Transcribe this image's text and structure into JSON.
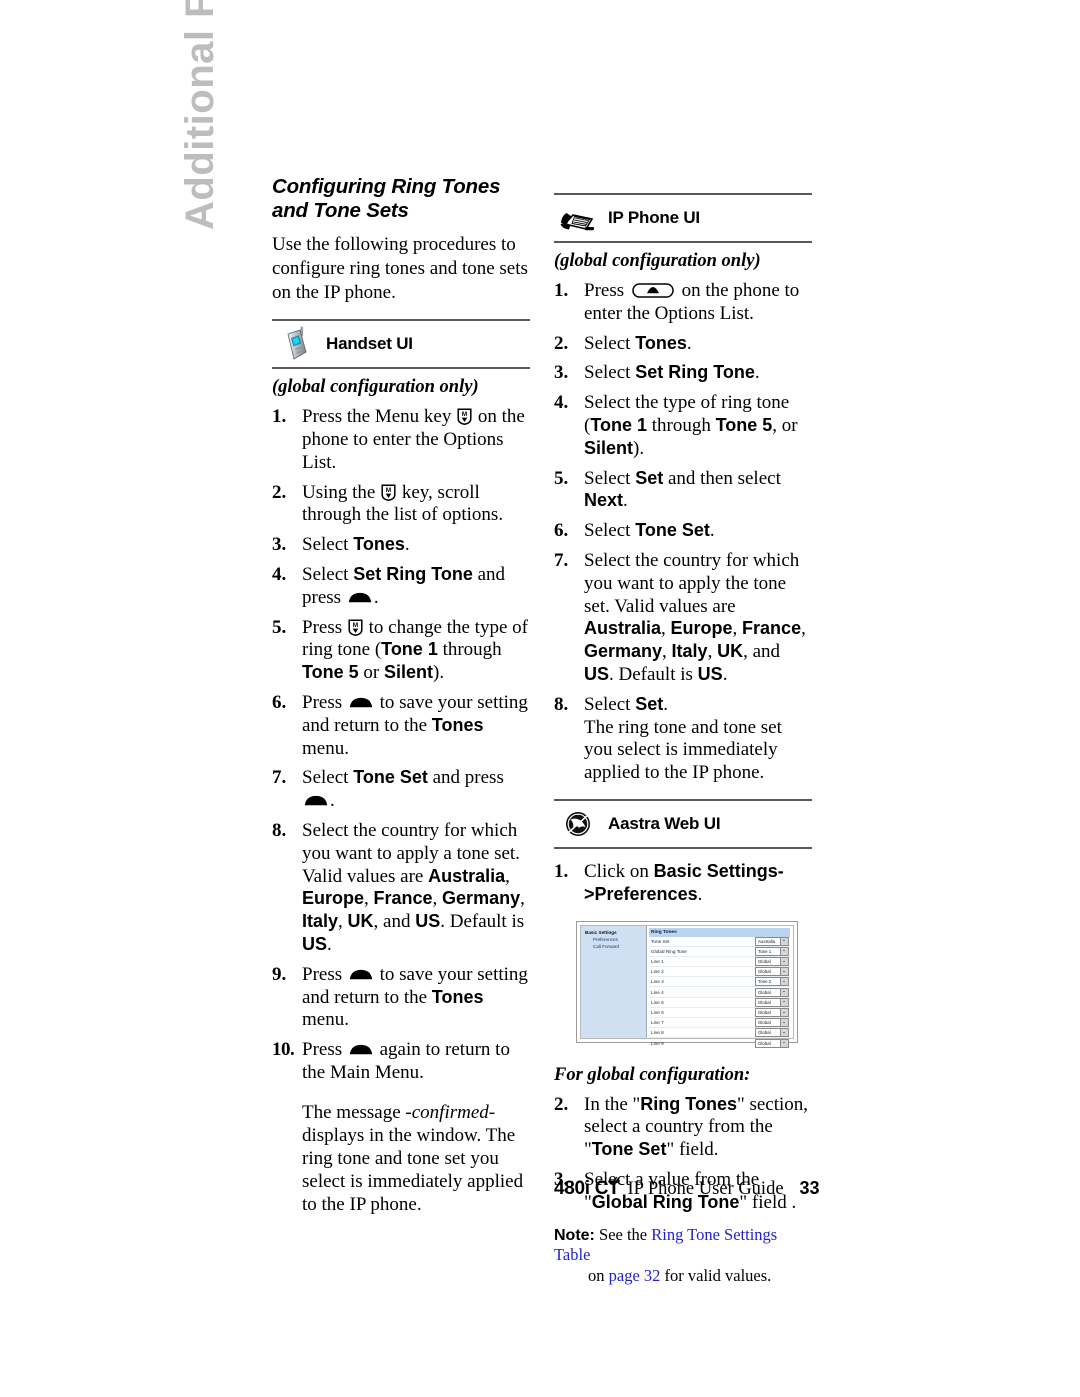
{
  "chapter_tab": {
    "label": "Additional Features"
  },
  "section": {
    "title": "Configuring Ring Tones and Tone Sets",
    "intro": "Use the following procedures to configure ring tones and tone sets on the IP phone."
  },
  "handset_ui": {
    "icon": "cordless-handset-icon",
    "label": "Handset UI",
    "scope_note": "(global configuration only)",
    "steps": [
      {
        "num": "1.",
        "text_before": "Press the Menu key ",
        "glyph": "menu-key-icon",
        "text_after": " on the phone to enter the Options List."
      },
      {
        "num": "2.",
        "text_before": "Using the ",
        "glyph": "menu-key-icon",
        "text_after": " key, scroll through the list of options."
      },
      {
        "num": "3.",
        "text_before": "Select ",
        "bold": "Tones",
        "text_after": "."
      },
      {
        "num": "4.",
        "text_before": "Select ",
        "bold": "Set Ring Tone",
        "text_mid": " and press ",
        "glyph": "dome-key-icon",
        "text_after": "."
      },
      {
        "num": "5.",
        "text_before": "Press ",
        "glyph": "menu-key-icon",
        "text_mid": " to change the type of ring tone (",
        "bold": "Tone 1",
        "text_mid2": " through ",
        "bold2": "Tone 5",
        "text_mid3": " or ",
        "bold3": "Silent",
        "text_after": ")."
      },
      {
        "num": "6.",
        "text_before": "Press ",
        "glyph": "dome-key-icon",
        "text_mid": " to save your setting and return to the ",
        "bold": "Tones",
        "text_after": " menu."
      },
      {
        "num": "7.",
        "text_before": "Select ",
        "bold": "Tone Set",
        "text_mid": " and press ",
        "glyph": "dome-key-icon",
        "text_after": "."
      },
      {
        "num": "8.",
        "text_before": "Select the country for which you want to apply a tone set. Valid values are ",
        "bold": "Australia",
        "sep1": ", ",
        "bold2": "Europe",
        "sep2": ", ",
        "bold3": "France",
        "sep3": ", ",
        "bold4": "Germany",
        "sep4": ", ",
        "bold5": "Italy",
        "sep5": ", ",
        "bold6": "UK",
        "sep6": ", and ",
        "bold7": "US",
        "sep7": ". Default is ",
        "bold8": "US",
        "text_after": "."
      },
      {
        "num": "9.",
        "text_before": "Press ",
        "glyph": "dome-key-icon",
        "text_mid": " to save your setting and return to the ",
        "bold": "Tones",
        "text_after": " menu."
      },
      {
        "num": "10.",
        "text_before": "Press ",
        "glyph": "dome-key-icon",
        "text_after": " again to return to the Main Menu."
      }
    ],
    "closing_paragraph_a": "The message ",
    "closing_paragraph_em": "-confirmed-",
    "closing_paragraph_b": " displays in the window. The ring tone and tone set you select is immediately applied to the IP phone."
  },
  "ip_phone_ui": {
    "icon": "desk-phone-icon",
    "label": "IP Phone UI",
    "scope_note": "(global configuration only)",
    "steps": [
      {
        "num": "1.",
        "text_before": "Press ",
        "glyph": "oval-up-key-icon",
        "text_after": " on the phone to enter the Options List."
      },
      {
        "num": "2.",
        "text_before": "Select ",
        "bold": "Tones",
        "text_after": "."
      },
      {
        "num": "3.",
        "text_before": "Select ",
        "bold": "Set Ring Tone",
        "text_after": "."
      },
      {
        "num": "4.",
        "text_before": "Select the type of ring tone (",
        "bold": "Tone 1",
        "text_mid": " through ",
        "bold2": "Tone 5",
        "text_mid2": ", or ",
        "bold3": "Silent",
        "text_after": ")."
      },
      {
        "num": "5.",
        "text_before": "Select ",
        "bold": "Set",
        "text_mid": " and then select ",
        "bold2": "Next",
        "text_after": "."
      },
      {
        "num": "6.",
        "text_before": "Select ",
        "bold": "Tone Set",
        "text_after": "."
      },
      {
        "num": "7.",
        "text_before": "Select the country for which you want to apply the tone set. Valid values are ",
        "bold": "Australia",
        "sep1": ", ",
        "bold2": "Europe",
        "sep2": ", ",
        "bold3": "France",
        "sep3": ", ",
        "bold4": "Germany",
        "sep4": ", ",
        "bold5": "Italy",
        "sep5": ", ",
        "bold6": "UK",
        "sep6": ", and ",
        "bold7": "US",
        "sep7": ". Default is ",
        "bold8": "US",
        "text_after": "."
      },
      {
        "num": "8.",
        "text_before": "Select ",
        "bold": "Set",
        "text_after": ".",
        "extra": "The ring tone and tone set you select is immediately applied to the IP phone."
      }
    ]
  },
  "aastra_web_ui": {
    "icon": "globe-icon",
    "label": "Aastra Web UI",
    "step1": {
      "num": "1.",
      "text_before": "Click on ",
      "bold": "Basic Settings->",
      "bold2": "Preferences",
      "text_after": "."
    },
    "screenshot": {
      "nav_title": "Basic Settings",
      "nav_items": [
        "Preferences",
        "Call Forward"
      ],
      "section_header": "Ring Tones",
      "rows": [
        {
          "label": "Tone Set",
          "value": "Australia"
        },
        {
          "label": "Global Ring Tone",
          "value": "Tone 1"
        },
        {
          "label": "Line 1",
          "value": "Global"
        },
        {
          "label": "Line 2",
          "value": "Global"
        },
        {
          "label": "Line 3",
          "value": "Tone 2"
        },
        {
          "label": "Line 4",
          "value": "Global"
        },
        {
          "label": "Line 5",
          "value": "Global"
        },
        {
          "label": "Line 6",
          "value": "Global"
        },
        {
          "label": "Line 7",
          "value": "Global"
        },
        {
          "label": "Line 8",
          "value": "Global"
        },
        {
          "label": "Line 9",
          "value": "Global"
        }
      ]
    },
    "global_heading": "For global configuration:",
    "steps": [
      {
        "num": "2.",
        "text_before": "In the \"",
        "bold": "Ring Tones",
        "text_mid": "\" section, select a country from the \"",
        "bold2": "Tone Set",
        "text_after": "\" field."
      },
      {
        "num": "3.",
        "text_before": "Select a value from the \"",
        "bold": "Global Ring Tone",
        "text_after": "\" field ."
      }
    ],
    "note": {
      "label": "Note:",
      "text_before": " See the ",
      "link1": "Ring Tone Settings Table",
      "text_mid": "on ",
      "link2": "page 32",
      "text_after": " for valid values."
    }
  },
  "footer": {
    "model": "480i",
    "model_suffix": "CT",
    "guide": "IP Phone User Guide",
    "page_number": "33"
  },
  "colors": {
    "rule": "#5a5a5a",
    "tab_text": "#bdbdbd",
    "link": "#2222cc",
    "shot_nav_bg": "#cfe0f2",
    "shot_header_bg": "#b9d4ee"
  }
}
